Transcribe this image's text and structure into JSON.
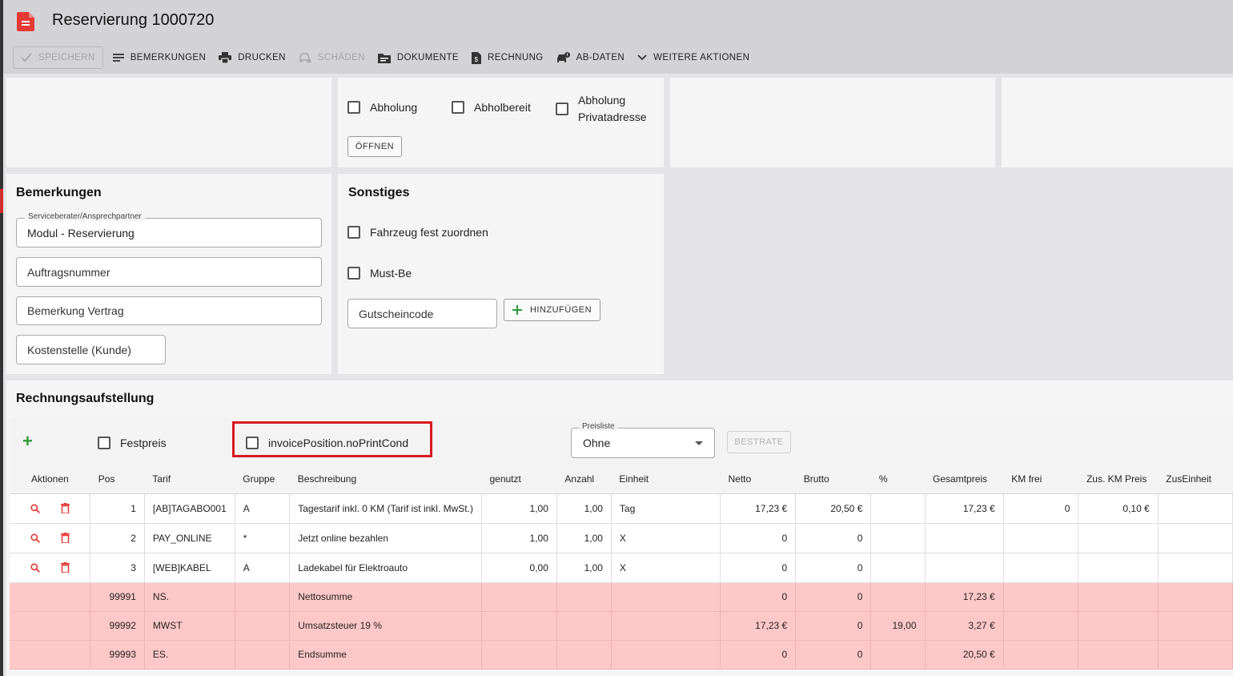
{
  "header": {
    "title": "Reservierung 1000720"
  },
  "toolbar": {
    "save": "SPEICHERN",
    "remarks": "BEMERKUNGEN",
    "print": "DRUCKEN",
    "damages": "SCHÄDEN",
    "documents": "DOKUMENTE",
    "invoice": "RECHNUNG",
    "ab_data": "AB-DATEN",
    "more": "WEITERE AKTIONEN"
  },
  "pickup": {
    "abholung": "Abholung",
    "abholbereit": "Abholbereit",
    "privat_line1": "Abholung",
    "privat_line2": "Privatadresse",
    "open_button": "ÖFFNEN"
  },
  "remarks": {
    "title": "Bemerkungen",
    "advisor_label": "Serviceberater/Ansprechpartner",
    "advisor_value": "Modul - Reservierung",
    "order_number_placeholder": "Auftragsnummer",
    "contract_remark_placeholder": "Bemerkung Vertrag",
    "cost_center_placeholder": "Kostenstelle (Kunde)"
  },
  "misc": {
    "title": "Sonstiges",
    "assign_vehicle": "Fahrzeug fest zuordnen",
    "must_be": "Must-Be",
    "voucher_placeholder": "Gutscheincode",
    "add_button": "HINZUFÜGEN"
  },
  "invoice": {
    "title": "Rechnungsaufstellung",
    "fixed_price": "Festpreis",
    "no_print_cond": "invoicePosition.noPrintCond",
    "pricelist_label": "Preisliste",
    "pricelist_value": "Ohne",
    "best_rate": "BESTRATE",
    "columns": [
      "Aktionen",
      "Pos",
      "Tarif",
      "Gruppe",
      "Beschreibung",
      "genutzt",
      "Anzahl",
      "Einheit",
      "Netto",
      "Brutto",
      "%",
      "Gesamtpreis",
      "KM frei",
      "Zus. KM Preis",
      "ZusEinheit"
    ],
    "rows": [
      {
        "pos": "1",
        "tarif": "[AB]TAGABO001",
        "gruppe": "A",
        "beschreibung": "Tagestarif inkl. 0 KM (Tarif ist inkl. MwSt.)",
        "genutzt": "1,00",
        "anzahl": "1,00",
        "einheit": "Tag",
        "netto": "17,23 €",
        "brutto": "20,50 €",
        "pct": "",
        "gesamt": "17,23 €",
        "km_frei": "0",
        "zus_km": "0,10 €",
        "zus_einheit": ""
      },
      {
        "pos": "2",
        "tarif": "PAY_ONLINE",
        "gruppe": "*",
        "beschreibung": "Jetzt online bezahlen",
        "genutzt": "1,00",
        "anzahl": "1,00",
        "einheit": "X",
        "netto": "0",
        "brutto": "0",
        "pct": "",
        "gesamt": "",
        "km_frei": "",
        "zus_km": "",
        "zus_einheit": ""
      },
      {
        "pos": "3",
        "tarif": "[WEB]KABEL",
        "gruppe": "A",
        "beschreibung": "Ladekabel für Elektroauto",
        "genutzt": "0,00",
        "anzahl": "1,00",
        "einheit": "X",
        "netto": "0",
        "brutto": "0",
        "pct": "",
        "gesamt": "",
        "km_frei": "",
        "zus_km": "",
        "zus_einheit": ""
      }
    ],
    "sum_rows": [
      {
        "pos": "99991",
        "tarif": "NS.",
        "beschreibung": "Nettosumme",
        "netto": "0",
        "brutto": "0",
        "pct": "",
        "gesamt": "17,23 €"
      },
      {
        "pos": "99992",
        "tarif": "MWST",
        "beschreibung": "Umsatzsteuer 19 %",
        "netto": "17,23 €",
        "brutto": "0",
        "pct": "19,00",
        "gesamt": "3,27 €"
      },
      {
        "pos": "99993",
        "tarif": "ES.",
        "beschreibung": "Endsumme",
        "netto": "0",
        "brutto": "0",
        "pct": "",
        "gesamt": "20,50 €"
      }
    ]
  },
  "colors": {
    "header_bg": "#d3d3d5",
    "panel_bg": "#f5f5f5",
    "sum_row_bg": "#ffc8c8",
    "highlight_border": "#d71920",
    "accent_green": "#2e9b3b",
    "icon_red": "#e53935"
  },
  "icons": {
    "doc": "document-icon",
    "search": "magnify-icon",
    "delete": "trash-icon"
  }
}
